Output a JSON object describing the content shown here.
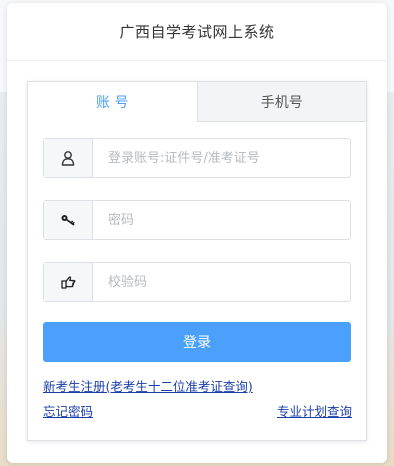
{
  "header": {
    "title": "广西自学考试网上系统"
  },
  "tabs": [
    {
      "label": "账 号",
      "active": true
    },
    {
      "label": "手机号",
      "active": false
    }
  ],
  "form": {
    "account_placeholder": "登录账号:证件号/准考证号",
    "password_placeholder": "密码",
    "captcha_placeholder": "校验码",
    "login_label": "登录"
  },
  "links": {
    "register": "新考生注册(老考生十二位准考证查询)",
    "forgot": "忘记密码",
    "plan": "专业计划查询"
  },
  "icons": {
    "account": "user-icon",
    "password": "key-icon",
    "captcha": "hand-pointer-icon"
  },
  "colors": {
    "accent": "#4aa0fa",
    "active_tab_text": "#4a9ff5",
    "link": "#1a3fa8"
  }
}
